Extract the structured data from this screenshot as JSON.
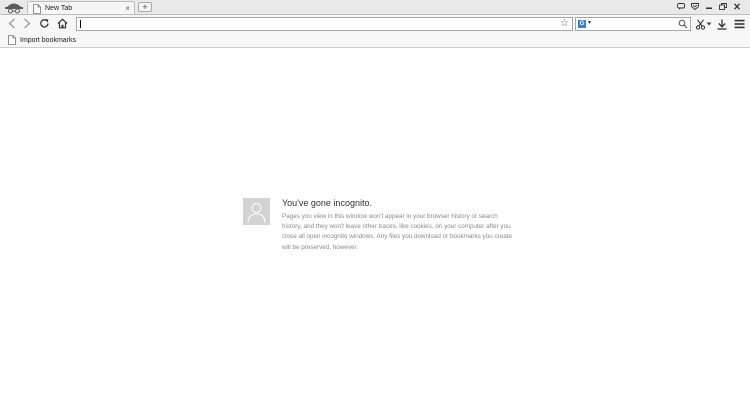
{
  "tabs": [
    {
      "title": "New Tab",
      "close_glyph": "×"
    }
  ],
  "new_tab_glyph": "+",
  "toolbar": {
    "back_icon": "back-arrow-icon",
    "forward_icon": "forward-arrow-icon",
    "reload_icon": "reload-icon",
    "home_icon": "home-icon",
    "star_icon": "star-icon",
    "search_engine_icon": "google-search-icon",
    "search_icon": "magnifier-icon"
  },
  "omnibox": {
    "value": "",
    "placeholder": ""
  },
  "search": {
    "value": "",
    "placeholder": "",
    "engine_glyph": "G"
  },
  "bookmarks_bar": [
    {
      "label": "Import bookmarks"
    }
  ],
  "incognito": {
    "title": "You've gone incognito.",
    "body": "Pages you view in this window won't appear in your browser history or search history, and they won't leave other traces, like cookies, on your computer after you close all open incognito windows. Any files you download or bookmarks you create will be preserved, however."
  },
  "colors": {
    "accent": "#3b7de0",
    "frame": "#e9e9e9",
    "toolbar": "#f6f6f6"
  }
}
